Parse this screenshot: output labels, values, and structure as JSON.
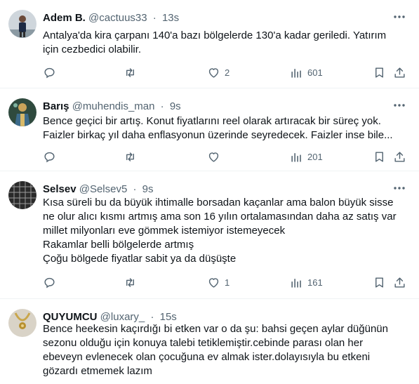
{
  "tweets": [
    {
      "name": "Adem B.",
      "handle": "@cactuus33",
      "separator": "·",
      "time": "13s",
      "avatar_icon": "avatar-man-standing",
      "lines": [
        "Antalya'da kira çarpanı 140'a bazı bölgelerde 130'a kadar geriledi. Yatırım",
        "için cezbedici olabilir."
      ],
      "replies": "",
      "retweets": "",
      "likes": "2",
      "views": "601"
    },
    {
      "name": "Barış",
      "handle": "@muhendis_man",
      "separator": "·",
      "time": "9s",
      "avatar_icon": "avatar-armored-figure",
      "lines": [
        "Bence geçici bir artış. Konut fiyatlarını reel olarak artıracak bir süreç yok.",
        "Faizler birkaç yıl daha enflasyonun üzerinde seyredecek. Faizler inse bile..."
      ],
      "replies": "",
      "retweets": "",
      "likes": "",
      "views": "201"
    },
    {
      "name": "Selsev",
      "handle": "@Selsev5",
      "separator": "·",
      "time": "9s",
      "avatar_icon": "avatar-grid-pattern",
      "lines": [
        "Kısa süreli bu da büyük ihtimalle borsadan kaçanlar ama balon büyük sisse",
        "ne olur alıcı kısmı artmış ama son 16 yılın ortalamasından daha az satış var",
        "millet milyonları eve gömmek istemiyor istemeyecek",
        "Rakamlar belli bölgelerde artmış",
        "Çoğu bölgede fiyatlar sabit ya da düşüşte"
      ],
      "replies": "",
      "retweets": "",
      "likes": "1",
      "views": "161"
    },
    {
      "name": "QUYUMCU",
      "handle": "@luxary_",
      "separator": "·",
      "time": "15s",
      "avatar_icon": "avatar-gold-necklace",
      "lines": [
        "Bence heekesin kaçırdığı bi etken var o da şu: bahsi geçen aylar düğünün",
        "sezonu olduğu için konuya talebi tetiklemiştir.cebinde parası olan her",
        "ebeveyn evlenecek olan çocuğuna ev almak ister.dolayısıyla bu etkeni",
        "gözardı etmemek lazım"
      ],
      "replies": "",
      "retweets": "",
      "likes": "",
      "views": ""
    }
  ],
  "colors": {
    "text": "#0f1419",
    "secondary": "#536471",
    "divider": "#eff3f4"
  },
  "icons": [
    "reply-icon",
    "retweet-icon",
    "like-icon",
    "views-icon",
    "bookmark-icon",
    "share-icon",
    "more-icon"
  ]
}
